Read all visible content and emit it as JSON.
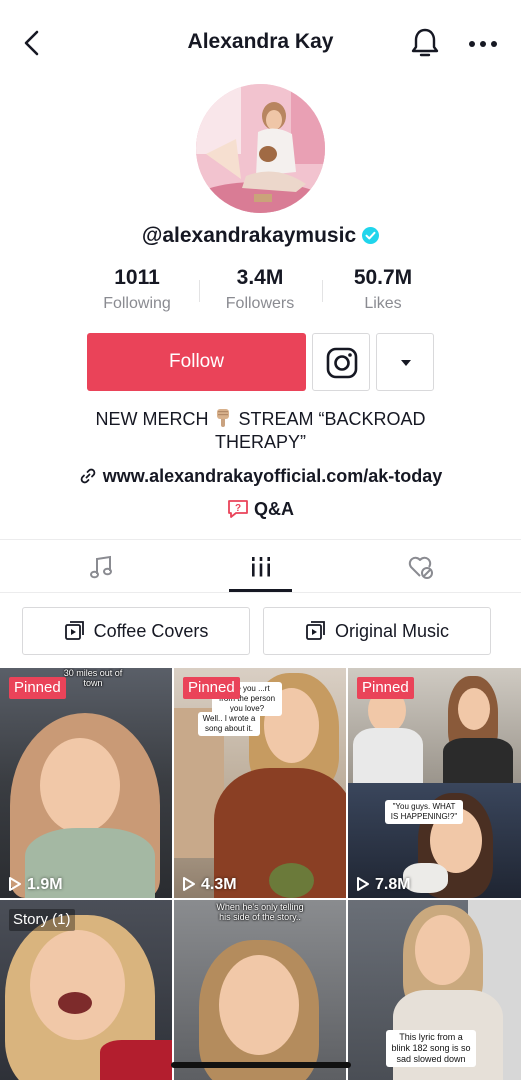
{
  "header": {
    "title": "Alexandra Kay",
    "back_icon": "chevron-left-icon",
    "bell_icon": "bell-icon",
    "more_icon": "more-horizontal-icon"
  },
  "profile": {
    "handle": "@alexandrakaymusic",
    "verified_color": "#20d5ec"
  },
  "stats": [
    {
      "value": "1011",
      "label": "Following"
    },
    {
      "value": "3.4M",
      "label": "Followers"
    },
    {
      "value": "50.7M",
      "label": "Likes"
    }
  ],
  "actions": {
    "follow_label": "Follow",
    "accent_color": "#ea4359"
  },
  "bio": {
    "line1_a": "NEW MERCH",
    "line1_b": "STREAM “BACKROAD",
    "line2": "THERAPY”",
    "link": "www.alexandrakayofficial.com/ak-today",
    "qa_label": "Q&A"
  },
  "tabs": [
    {
      "icon": "music-note-icon"
    },
    {
      "icon": "grid-icon",
      "active": true
    },
    {
      "icon": "liked-hidden-icon"
    }
  ],
  "playlists": [
    {
      "label": "Coffee Covers"
    },
    {
      "label": "Original Music"
    }
  ],
  "videos": [
    {
      "badge": "Pinned",
      "views": "1.9M",
      "caption": "30 miles out of town"
    },
    {
      "badge": "Pinned",
      "views": "4.3M",
      "caption_a": "t like you ...rt from the person you love?",
      "caption_b": "Well.. I wrote a song about it."
    },
    {
      "badge": "Pinned",
      "views": "7.8M",
      "caption": "\"You guys. WHAT IS HAPPENING!?\""
    },
    {
      "badge": "Story (1)"
    },
    {
      "caption": "When he's only telling his side of the story.."
    },
    {
      "caption": "This lyric from a blink 182 song is so sad slowed down"
    }
  ]
}
